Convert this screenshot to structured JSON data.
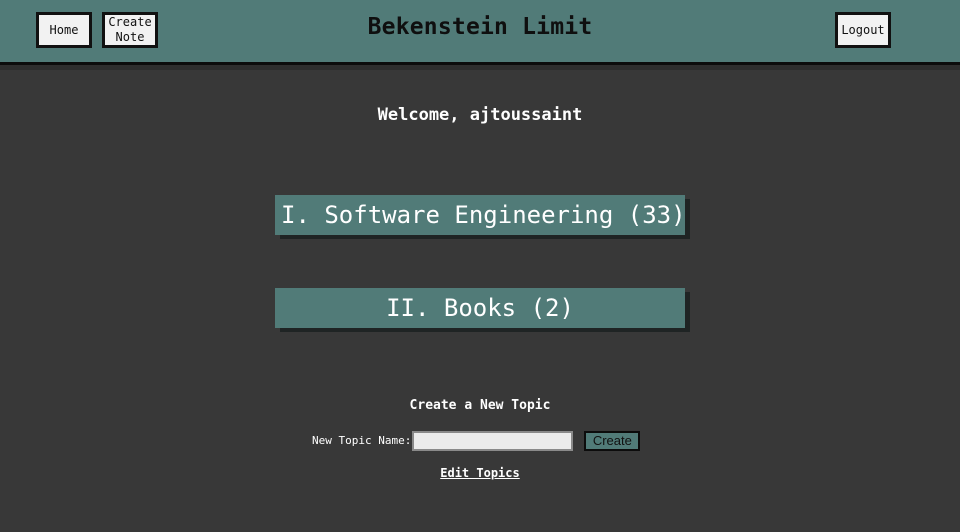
{
  "header": {
    "title": "Bekenstein Limit",
    "home_label": "Home",
    "create_note_label": "Create Note",
    "logout_label": "Logout"
  },
  "main": {
    "welcome": "Welcome, ajtoussaint",
    "topics": [
      {
        "label": "I. Software Engineering (33)"
      },
      {
        "label": "II. Books (2)"
      }
    ],
    "create_topic": {
      "heading": "Create a New Topic",
      "name_label": "New Topic Name:",
      "input_value": "",
      "button_label": "Create"
    },
    "edit_topics_label": "Edit Topics"
  },
  "colors": {
    "background": "#383838",
    "accent": "#517b78",
    "button_bg": "#f2f2f2"
  }
}
